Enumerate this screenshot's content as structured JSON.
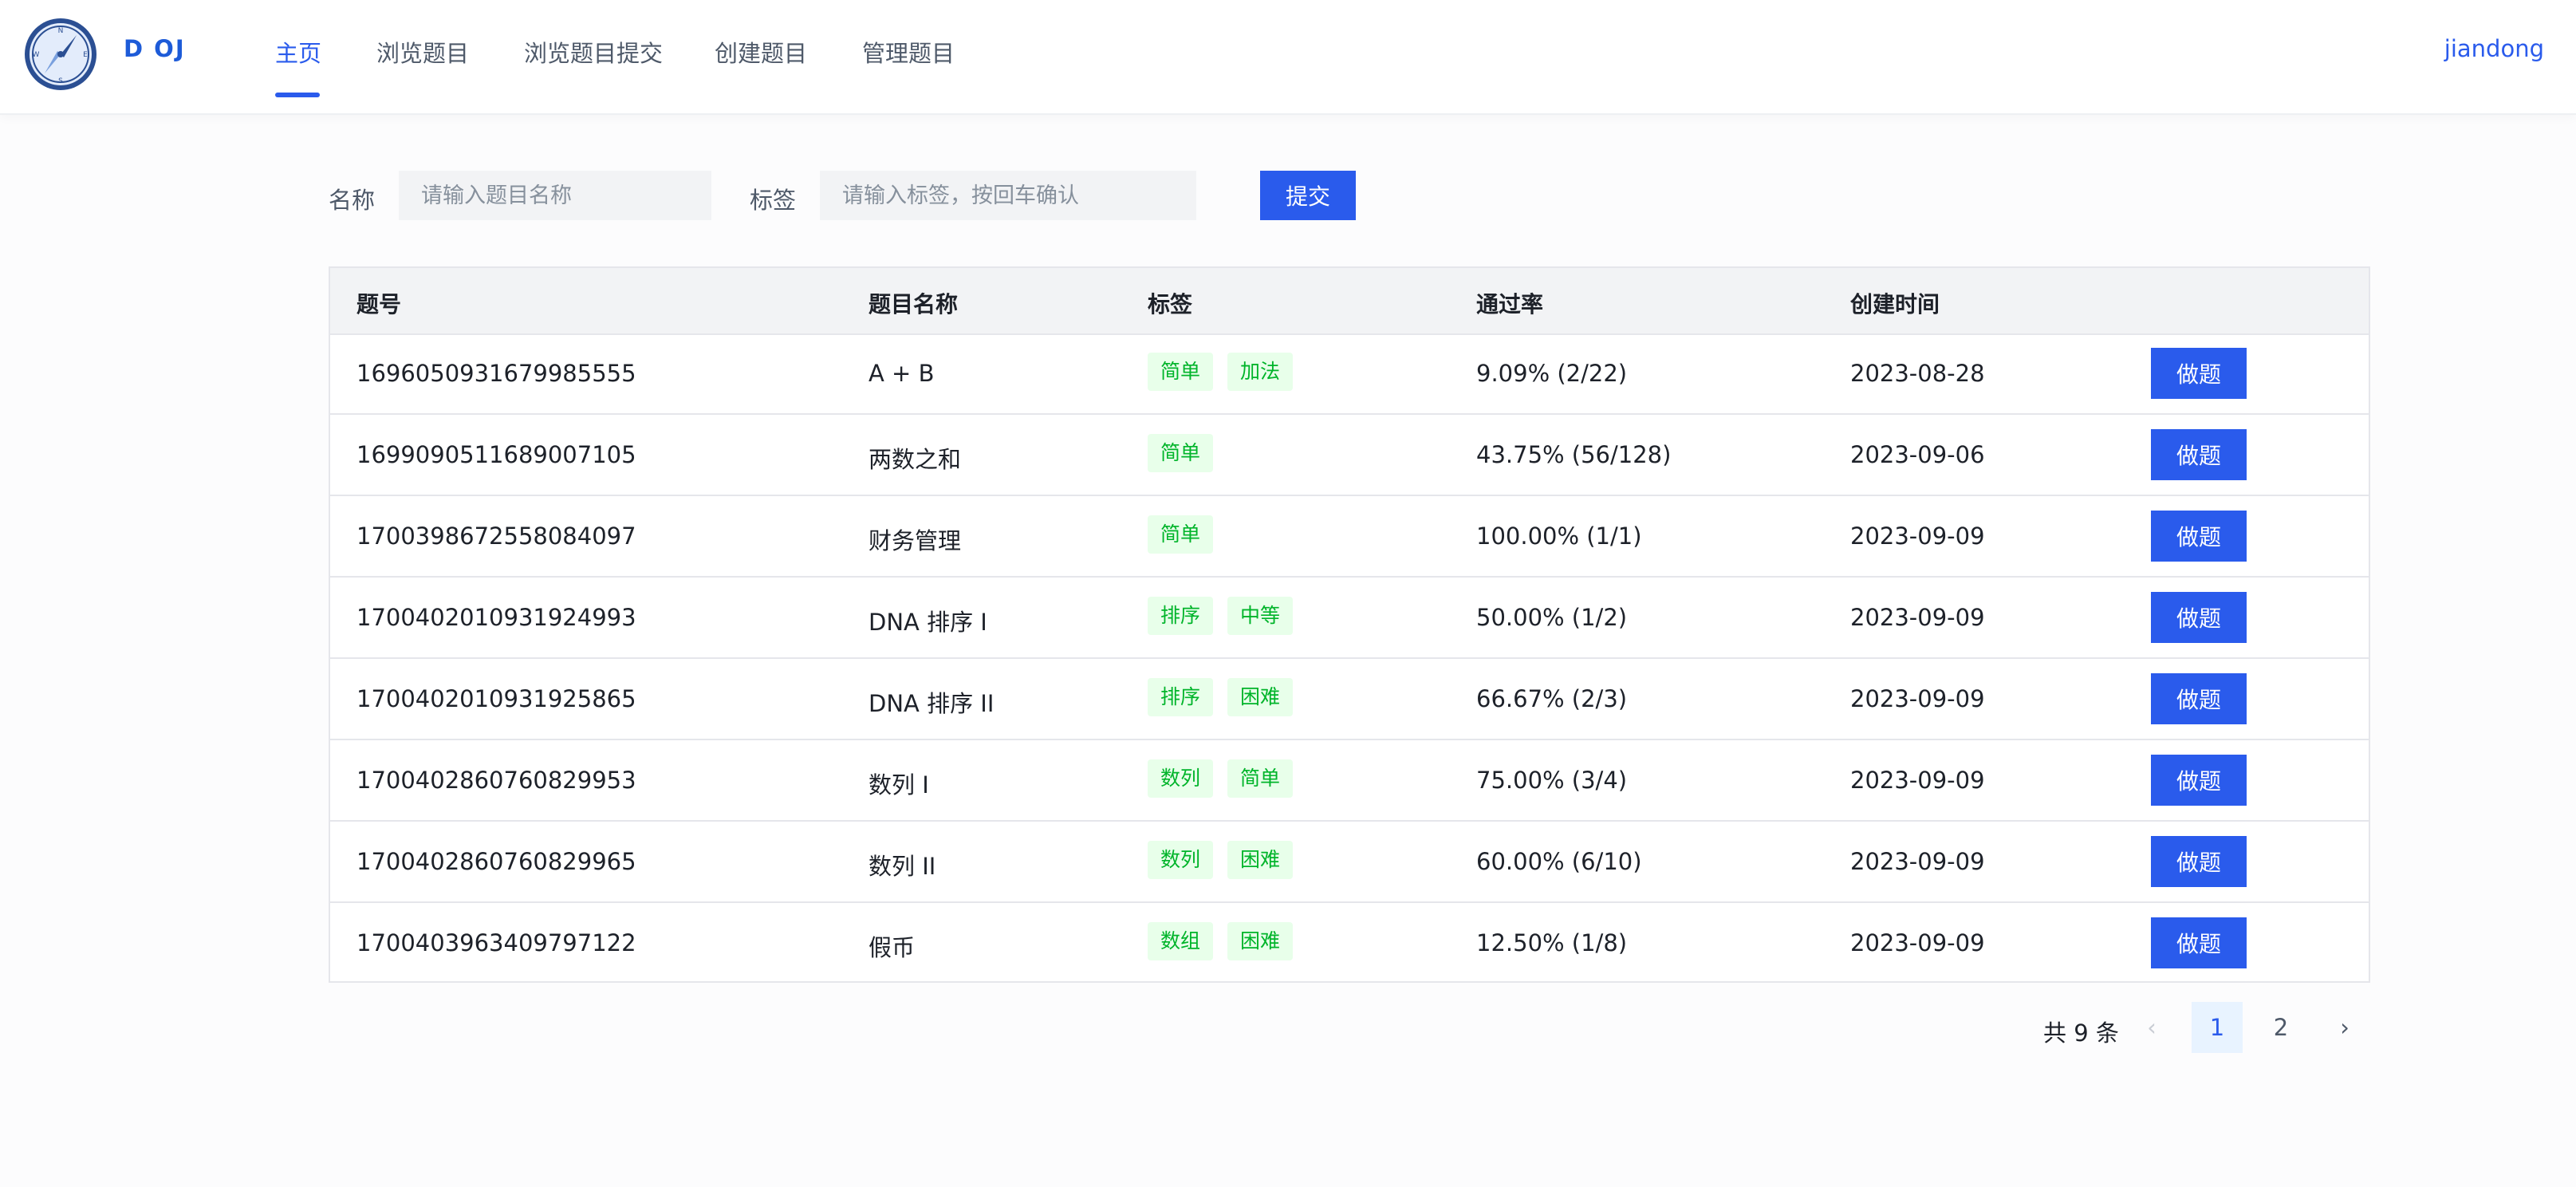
{
  "header": {
    "brand": "D OJ",
    "nav": [
      "主页",
      "浏览题目",
      "浏览题目提交",
      "创建题目",
      "管理题目"
    ],
    "active_index": 0,
    "user": "jiandong"
  },
  "search": {
    "name_label": "名称",
    "name_placeholder": "请输入题目名称",
    "tag_label": "标签",
    "tag_placeholder": "请输入标签，按回车确认",
    "submit_label": "提交"
  },
  "table": {
    "columns": [
      "题号",
      "题目名称",
      "标签",
      "通过率",
      "创建时间"
    ],
    "action_label": "做题",
    "rows": [
      {
        "id": "1696050931679985555",
        "name": "A + B",
        "tags": [
          "简单",
          "加法"
        ],
        "rate": "9.09% (2/22)",
        "date": "2023-08-28"
      },
      {
        "id": "1699090511689007105",
        "name": "两数之和",
        "tags": [
          "简单"
        ],
        "rate": "43.75% (56/128)",
        "date": "2023-09-06"
      },
      {
        "id": "1700398672558084097",
        "name": "财务管理",
        "tags": [
          "简单"
        ],
        "rate": "100.00% (1/1)",
        "date": "2023-09-09"
      },
      {
        "id": "1700402010931924993",
        "name": "DNA 排序 I",
        "tags": [
          "排序",
          "中等"
        ],
        "rate": "50.00% (1/2)",
        "date": "2023-09-09"
      },
      {
        "id": "1700402010931925865",
        "name": "DNA 排序 II",
        "tags": [
          "排序",
          "困难"
        ],
        "rate": "66.67% (2/3)",
        "date": "2023-09-09"
      },
      {
        "id": "1700402860760829953",
        "name": "数列 I",
        "tags": [
          "数列",
          "简单"
        ],
        "rate": "75.00% (3/4)",
        "date": "2023-09-09"
      },
      {
        "id": "1700402860760829965",
        "name": "数列 II",
        "tags": [
          "数列",
          "困难"
        ],
        "rate": "60.00% (6/10)",
        "date": "2023-09-09"
      },
      {
        "id": "1700403963409797122",
        "name": "假币",
        "tags": [
          "数组",
          "困难"
        ],
        "rate": "12.50% (1/8)",
        "date": "2023-09-09"
      }
    ]
  },
  "pagination": {
    "total_text": "共 9 条",
    "prev_icon": "‹",
    "next_icon": "›",
    "pages": [
      "1",
      "2"
    ],
    "current": "1"
  },
  "colors": {
    "accent": "#2a5bec",
    "tag_bg": "#e8ffea",
    "tag_text": "#00b42a"
  },
  "icons": {
    "logo": "compass-icon",
    "prev": "chevron-left-icon",
    "next": "chevron-right-icon"
  }
}
